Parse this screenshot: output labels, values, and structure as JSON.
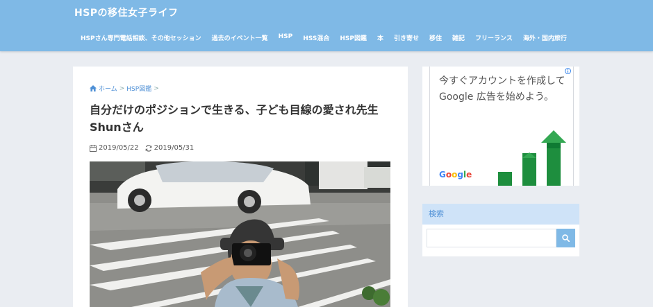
{
  "header": {
    "site_title": "HSPの移住女子ライフ",
    "nav": [
      "HSPさん専門電話相談、その他セッション",
      "過去のイベント一覧",
      "HSP",
      "HSS混合",
      "HSP図鑑",
      "本",
      "引き寄せ",
      "移住",
      "雑記",
      "フリーランス",
      "海外・国内旅行"
    ]
  },
  "breadcrumb": {
    "home": "ホーム",
    "category": "HSP図鑑",
    "separator": ">"
  },
  "article": {
    "title": "自分だけのポジションで生きる、子ども目線の愛され先生Shunさん",
    "published": "2019/05/22",
    "updated": "2019/05/31"
  },
  "ad": {
    "line1": "今すぐアカウントを作成して",
    "line2": "Google 広告を始めよう。",
    "logo_letters": [
      "G",
      "o",
      "o",
      "g",
      "l",
      "e"
    ]
  },
  "sidebar": {
    "search_title": "検索",
    "search_placeholder": ""
  },
  "colors": {
    "header_bg": "#7fb9e6",
    "accent": "#4f90d6",
    "page_bg": "#eaedf2"
  },
  "icons": {
    "home": "home-icon",
    "calendar": "calendar-icon",
    "refresh": "refresh-icon",
    "search": "search-icon",
    "ad_info": "info-icon"
  }
}
